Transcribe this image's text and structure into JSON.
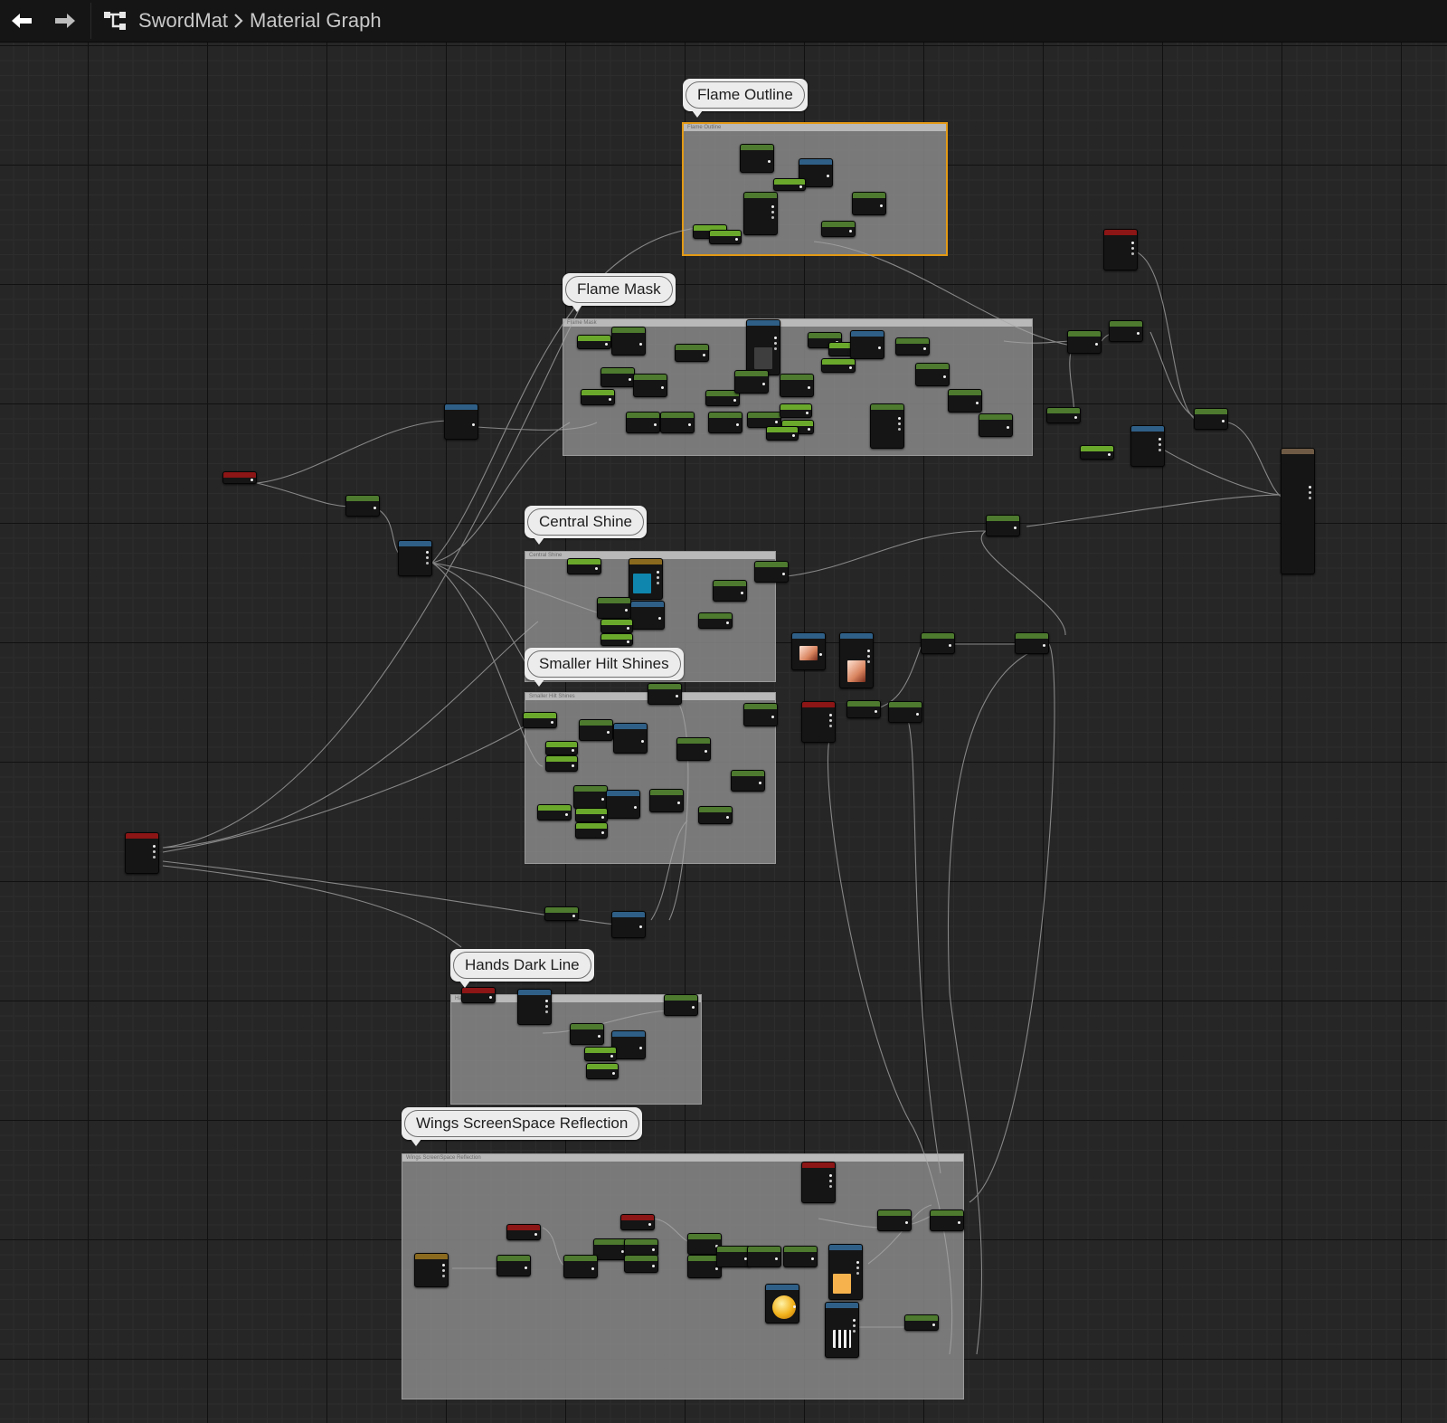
{
  "toolbar": {
    "back_icon": "arrow-left-icon",
    "forward_icon": "arrow-right-icon",
    "graph_icon": "material-graph-icon",
    "breadcrumb": [
      "SwordMat",
      "Material Graph"
    ]
  },
  "comments": {
    "flame_outline": "Flame Outline",
    "flame_mask": "Flame Mask",
    "central_shine": "Central Shine",
    "smaller_hilt_shines": "Smaller Hilt Shines",
    "hands_dark_line": "Hands Dark Line",
    "wings_ssr": "Wings ScreenSpace Reflection"
  },
  "colors": {
    "green_node": "#4d7a2e",
    "bright_green_node": "#6aa82c",
    "blue_node": "#2f5f86",
    "red_node": "#8c1515",
    "gold_node": "#8a6a1e",
    "selected_outline": "#e39a16",
    "canvas_bg": "#262626"
  }
}
